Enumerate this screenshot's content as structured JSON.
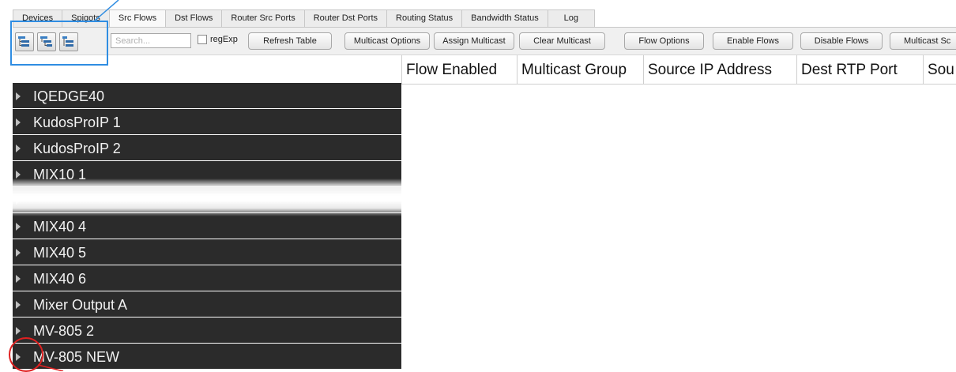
{
  "tabs": [
    {
      "label": "Devices",
      "active": false
    },
    {
      "label": "Spigots",
      "active": false
    },
    {
      "label": "Src Flows",
      "active": true
    },
    {
      "label": "Dst Flows",
      "active": false
    },
    {
      "label": "Router Src Ports",
      "active": false
    },
    {
      "label": "Router Dst Ports",
      "active": false
    },
    {
      "label": "Routing Status",
      "active": false
    },
    {
      "label": "Bandwidth Status",
      "active": false
    },
    {
      "label": "Log",
      "active": false
    }
  ],
  "toolbar": {
    "icon_names": [
      "expand-tree-icon",
      "collapse-tree-icon",
      "tree-level-icon"
    ],
    "search_placeholder": "Search...",
    "regexp_label": "regExp",
    "buttons": [
      "Refresh Table",
      "Multicast Options",
      "Assign Multicast",
      "Clear Multicast",
      "Flow Options",
      "Enable Flows",
      "Disable Flows",
      "Multicast Sc"
    ]
  },
  "table": {
    "columns": [
      "Flow Enabled",
      "Multicast Group",
      "Source IP Address",
      "Dest RTP Port",
      "Sou"
    ],
    "rows": [
      "IQEDGE40",
      "KudosProIP 1",
      "KudosProIP 2",
      "MIX10 1",
      "",
      "MIX40 4",
      "MIX40 5",
      "MIX40 6",
      "Mixer Output A",
      "MV-805 2",
      "MV-805 NEW"
    ]
  },
  "colors": {
    "highlight_blue": "#2f8de2",
    "highlight_red": "#e02020",
    "row_bg": "#2b2b2b"
  }
}
